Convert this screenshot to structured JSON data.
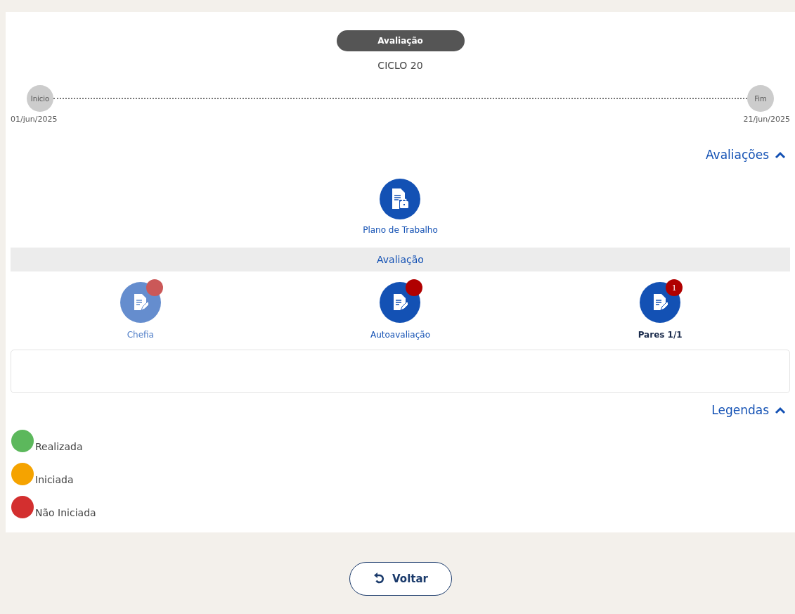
{
  "header": {
    "badge": "Avaliação",
    "cycle": "CICLO 20"
  },
  "timeline": {
    "start": {
      "label": "Inicio",
      "date": "01/jun/2025"
    },
    "end": {
      "label": "Fim",
      "date": "21/jun/2025"
    }
  },
  "evaluations_toggle": {
    "label": "Avaliações",
    "expanded": true
  },
  "work_plan": {
    "label": "Plano de Trabalho"
  },
  "section_title": "Avaliação",
  "evaluations": [
    {
      "label": "Chefia",
      "disabled": true,
      "selected": false
    },
    {
      "label": "Autoavaliação",
      "disabled": false,
      "selected": false
    },
    {
      "label": "Pares 1/1",
      "disabled": false,
      "selected": true,
      "badge": "1"
    }
  ],
  "legend_toggle": {
    "label": "Legendas",
    "expanded": true
  },
  "legend": [
    {
      "label": "Realizada",
      "color": "#5cb85c"
    },
    {
      "label": "Iniciada",
      "color": "#f5a300"
    },
    {
      "label": "Não Iniciada",
      "color": "#d32f2f"
    }
  ],
  "back_button": {
    "label": "Voltar"
  }
}
